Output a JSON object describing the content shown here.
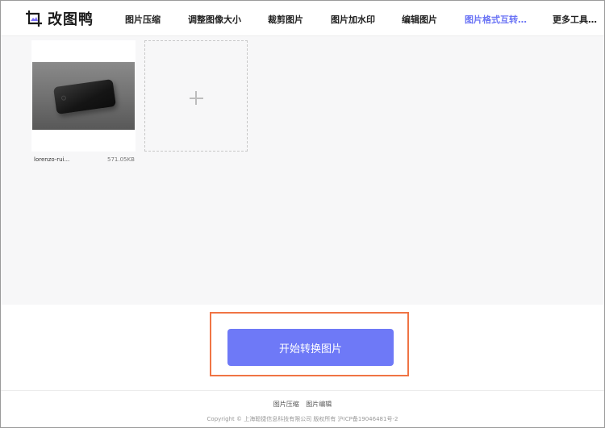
{
  "header": {
    "logo_text": "改图鸭",
    "nav": [
      {
        "label": "图片压缩"
      },
      {
        "label": "调整图像大小"
      },
      {
        "label": "裁剪图片"
      },
      {
        "label": "图片加水印"
      },
      {
        "label": "编辑图片"
      },
      {
        "label": "图片格式互转…",
        "active": true
      },
      {
        "label": "更多工具…"
      }
    ]
  },
  "upload": {
    "file": {
      "name": "lorenzo-rui...",
      "size": "571.05KB"
    },
    "add_icon": "plus-icon"
  },
  "action": {
    "start_label": "开始转换图片"
  },
  "colors": {
    "accent": "#6e79f7",
    "highlight": "#f07444",
    "active_nav": "#6b74f5"
  },
  "footer": {
    "links": [
      "图片压缩",
      "图片编辑"
    ],
    "copyright": "Copyright © 上海聪捷信息科技有限公司 版权所有 沪ICP备19046481号-2"
  }
}
